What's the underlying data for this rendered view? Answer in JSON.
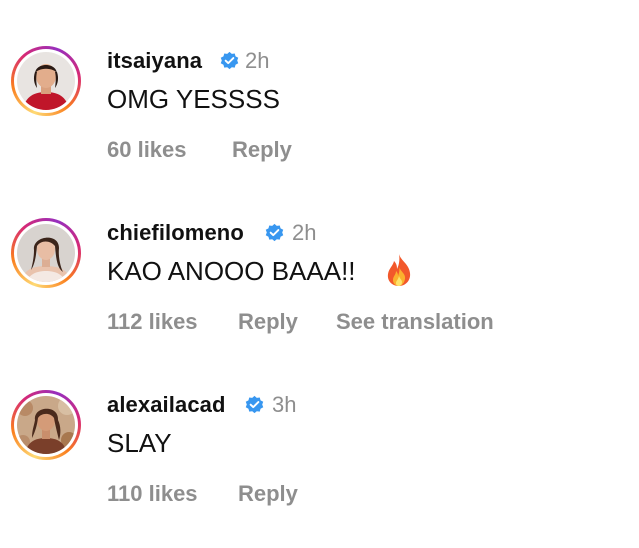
{
  "comments": [
    {
      "username": "itsaiyana",
      "time": "2h",
      "text": "OMG YESSSS",
      "likes": "60 likes",
      "reply": "Reply",
      "verified_icon": "verified-badge-icon",
      "avatar_icon": "profile-photo"
    },
    {
      "username": "chiefilomeno",
      "time": "2h",
      "text": "KAO ANOOO BAAA!!",
      "emoji_icon": "fire-emoji-icon",
      "likes": "112 likes",
      "reply": "Reply",
      "see_translation": "See translation",
      "verified_icon": "verified-badge-icon",
      "avatar_icon": "profile-photo"
    },
    {
      "username": "alexailacad",
      "time": "3h",
      "text": "SLAY",
      "likes": "110 likes",
      "reply": "Reply",
      "verified_icon": "verified-badge-icon",
      "avatar_icon": "profile-photo"
    }
  ],
  "colors": {
    "text": "#111111",
    "secondary": "#8e8e8e",
    "verified_blue": "#3897f0",
    "story_ring_start": "#feda75",
    "story_ring_end": "#962fbf"
  }
}
